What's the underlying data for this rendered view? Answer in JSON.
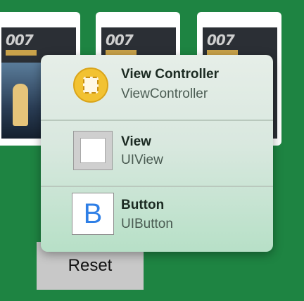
{
  "cards": [
    {
      "logo_text": "007"
    },
    {
      "logo_text": "007"
    },
    {
      "logo_text": "007"
    }
  ],
  "reset_button": {
    "label": "Reset"
  },
  "popover": {
    "items": [
      {
        "title": "View Controller",
        "subtitle": "ViewController",
        "icon": "view-controller-icon"
      },
      {
        "title": "View",
        "subtitle": "UIView",
        "icon": "view-icon"
      },
      {
        "title": "Button",
        "subtitle": "UIButton",
        "icon": "button-icon",
        "icon_glyph": "B"
      }
    ]
  },
  "colors": {
    "background": "#1e8442",
    "view_controller_icon": "#f2c232",
    "button_glyph": "#2f7fe6"
  }
}
